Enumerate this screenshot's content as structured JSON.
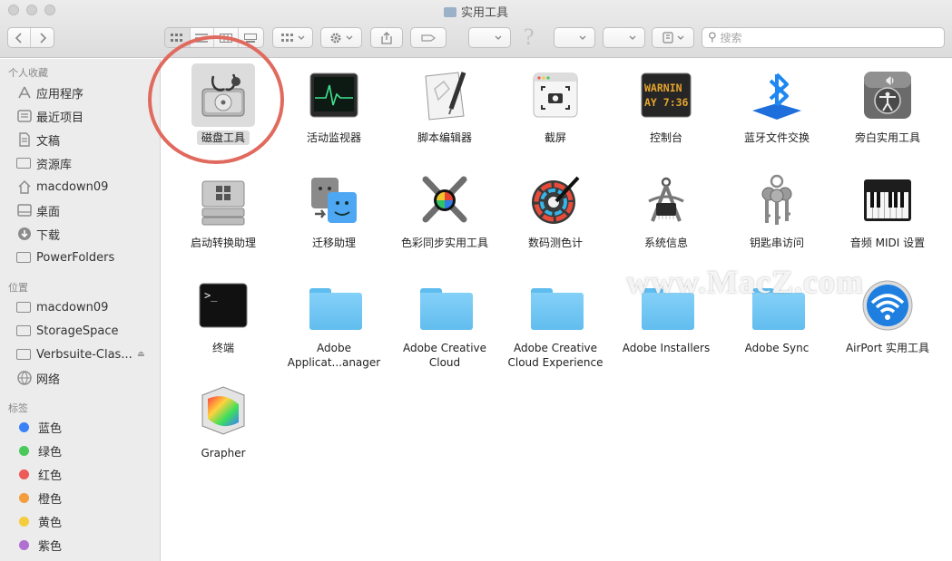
{
  "window": {
    "title": "实用工具"
  },
  "toolbar": {
    "search_placeholder": "搜索",
    "help_glyph": "?"
  },
  "sidebar": {
    "favorites_header": "个人收藏",
    "favorites": [
      {
        "label": "应用程序",
        "icon": "applications-icon"
      },
      {
        "label": "最近项目",
        "icon": "recents-icon"
      },
      {
        "label": "文稿",
        "icon": "documents-icon"
      },
      {
        "label": "资源库",
        "icon": "folder-icon"
      },
      {
        "label": "macdown09",
        "icon": "home-icon"
      },
      {
        "label": "桌面",
        "icon": "desktop-icon"
      },
      {
        "label": "下载",
        "icon": "downloads-icon"
      },
      {
        "label": "PowerFolders",
        "icon": "folder-icon"
      }
    ],
    "locations_header": "位置",
    "locations": [
      {
        "label": "macdown09",
        "icon": "disk-icon"
      },
      {
        "label": "StorageSpace",
        "icon": "disk-icon"
      },
      {
        "label": "Verbsuite-Clas...",
        "icon": "disk-icon"
      },
      {
        "label": "网络",
        "icon": "network-icon"
      }
    ],
    "tags_header": "标签",
    "tags": [
      {
        "label": "蓝色",
        "color": "#3b82f6"
      },
      {
        "label": "绿色",
        "color": "#4cc95b"
      },
      {
        "label": "红色",
        "color": "#ee5a57"
      },
      {
        "label": "橙色",
        "color": "#f59c3c"
      },
      {
        "label": "黄色",
        "color": "#f5cc3c"
      },
      {
        "label": "紫色",
        "color": "#b06fd1"
      }
    ]
  },
  "items": [
    {
      "label": "磁盘工具",
      "icon": "disk-utility-icon",
      "selected": true
    },
    {
      "label": "活动监视器",
      "icon": "activity-monitor-icon"
    },
    {
      "label": "脚本编辑器",
      "icon": "script-editor-icon"
    },
    {
      "label": "截屏",
      "icon": "screenshot-icon"
    },
    {
      "label": "控制台",
      "icon": "console-icon",
      "icon_text": "WARNIN AY 7:36"
    },
    {
      "label": "蓝牙文件交换",
      "icon": "bluetooth-icon"
    },
    {
      "label": "旁白实用工具",
      "icon": "voiceover-icon"
    },
    {
      "label": "启动转换助理",
      "icon": "bootcamp-icon"
    },
    {
      "label": "迁移助理",
      "icon": "migration-icon"
    },
    {
      "label": "色彩同步实用工具",
      "icon": "colorsync-icon"
    },
    {
      "label": "数码测色计",
      "icon": "color-meter-icon"
    },
    {
      "label": "系统信息",
      "icon": "system-info-icon"
    },
    {
      "label": "钥匙串访问",
      "icon": "keychain-icon"
    },
    {
      "label": "音频 MIDI 设置",
      "icon": "audio-midi-icon"
    },
    {
      "label": "终端",
      "icon": "terminal-icon",
      "icon_text": ">_"
    },
    {
      "label": "Adobe Applicat...anager",
      "icon": "folder-icon"
    },
    {
      "label": "Adobe Creative Cloud",
      "icon": "folder-icon"
    },
    {
      "label": "Adobe Creative Cloud Experience",
      "icon": "folder-icon"
    },
    {
      "label": "Adobe Installers",
      "icon": "folder-icon"
    },
    {
      "label": "Adobe Sync",
      "icon": "folder-icon"
    },
    {
      "label": "AirPort 实用工具",
      "icon": "airport-icon"
    },
    {
      "label": "Grapher",
      "icon": "grapher-icon"
    }
  ],
  "watermark": "www.MacZ.com"
}
